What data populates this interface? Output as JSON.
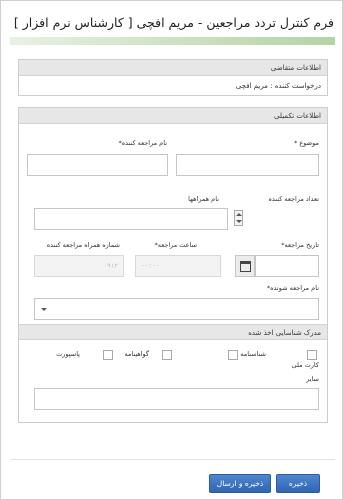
{
  "page": {
    "title": "فرم کنترل تردد مراجعین - مریم افچی [ کارشناس نرم افزار ]"
  },
  "applicant_section": {
    "heading": "اطلاعات متقاضی",
    "requester_line": "درخواست کننده : مریم افچی"
  },
  "details_section": {
    "heading": "اطلاعات تکمیلی",
    "subject": {
      "label": "موضوع *",
      "value": ""
    },
    "visitor_name": {
      "label": "نام مراجعه کننده*",
      "value": ""
    },
    "visitor_count": {
      "label": "تعداد مراجعه کننده",
      "value": ""
    },
    "companion_names": {
      "label": "نام همراهها",
      "value": ""
    },
    "visit_date": {
      "label": "تاریخ مراجعه*",
      "value": ""
    },
    "visit_time": {
      "label": "ساعت مراجعه*",
      "placeholder": "--:--"
    },
    "companion_phone": {
      "label": "شماره همراه مراجعه کننده",
      "placeholder": "۰۹۱۲"
    },
    "host_name": {
      "label": "نام مراجعه شونده*",
      "selected": ""
    }
  },
  "id_section": {
    "heading": "مدرک شناسایی اخذ شده",
    "options": [
      {
        "label": "کارت ملی",
        "checked": false
      },
      {
        "label": "شناسنامه",
        "checked": false
      },
      {
        "label": "گواهینامه",
        "checked": false
      },
      {
        "label": "پاسپورت",
        "checked": false
      }
    ],
    "other": {
      "label": "سایر",
      "value": ""
    }
  },
  "actions": {
    "save": "ذخیره",
    "save_send": "ذخیره و ارسال"
  },
  "colors": {
    "accent_bar": "#b4d3a5",
    "button": "#3a70bd",
    "panel_header": "#e7e7e7"
  }
}
